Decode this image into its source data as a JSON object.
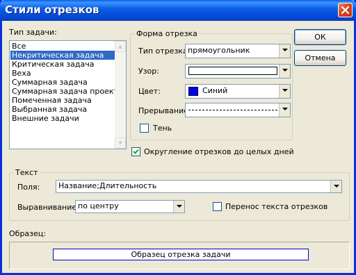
{
  "window": {
    "title": "Стили отрезков"
  },
  "task_type": {
    "label": "Тип задачи:",
    "items": [
      "Все",
      "Некритическая задача",
      "Критическая задача",
      "Веха",
      "Суммарная задача",
      "Суммарная задача проекта",
      "Помеченная задача",
      "Выбранная задача",
      "Внешние задачи"
    ],
    "selected": "Некритическая задача"
  },
  "bar_shape": {
    "group_label": "Форма отрезка",
    "type_label": "Тип отрезка:",
    "type_value": "прямоугольник",
    "pattern_label": "Узор:",
    "color_label": "Цвет:",
    "color_value": "Синий",
    "color_swatch": "#0000ff",
    "border_label": "Прерывание:",
    "shadow_label": "Тень",
    "shadow_checked": false
  },
  "buttons": {
    "ok": "ОК",
    "cancel": "Отмена"
  },
  "rounding": {
    "label": "Округление отрезков до целых дней",
    "checked": true
  },
  "text_group": {
    "group_label": "Текст",
    "fields_label": "Поля:",
    "fields_value": "Название;Длительность",
    "align_label": "Выравнивание:",
    "align_value": "по центру",
    "wrap_label": "Перенос текста отрезков",
    "wrap_checked": false
  },
  "sample": {
    "label": "Образец:",
    "bar_text": "Образец отрезка задачи",
    "bar_border_color": "#0000c0"
  }
}
